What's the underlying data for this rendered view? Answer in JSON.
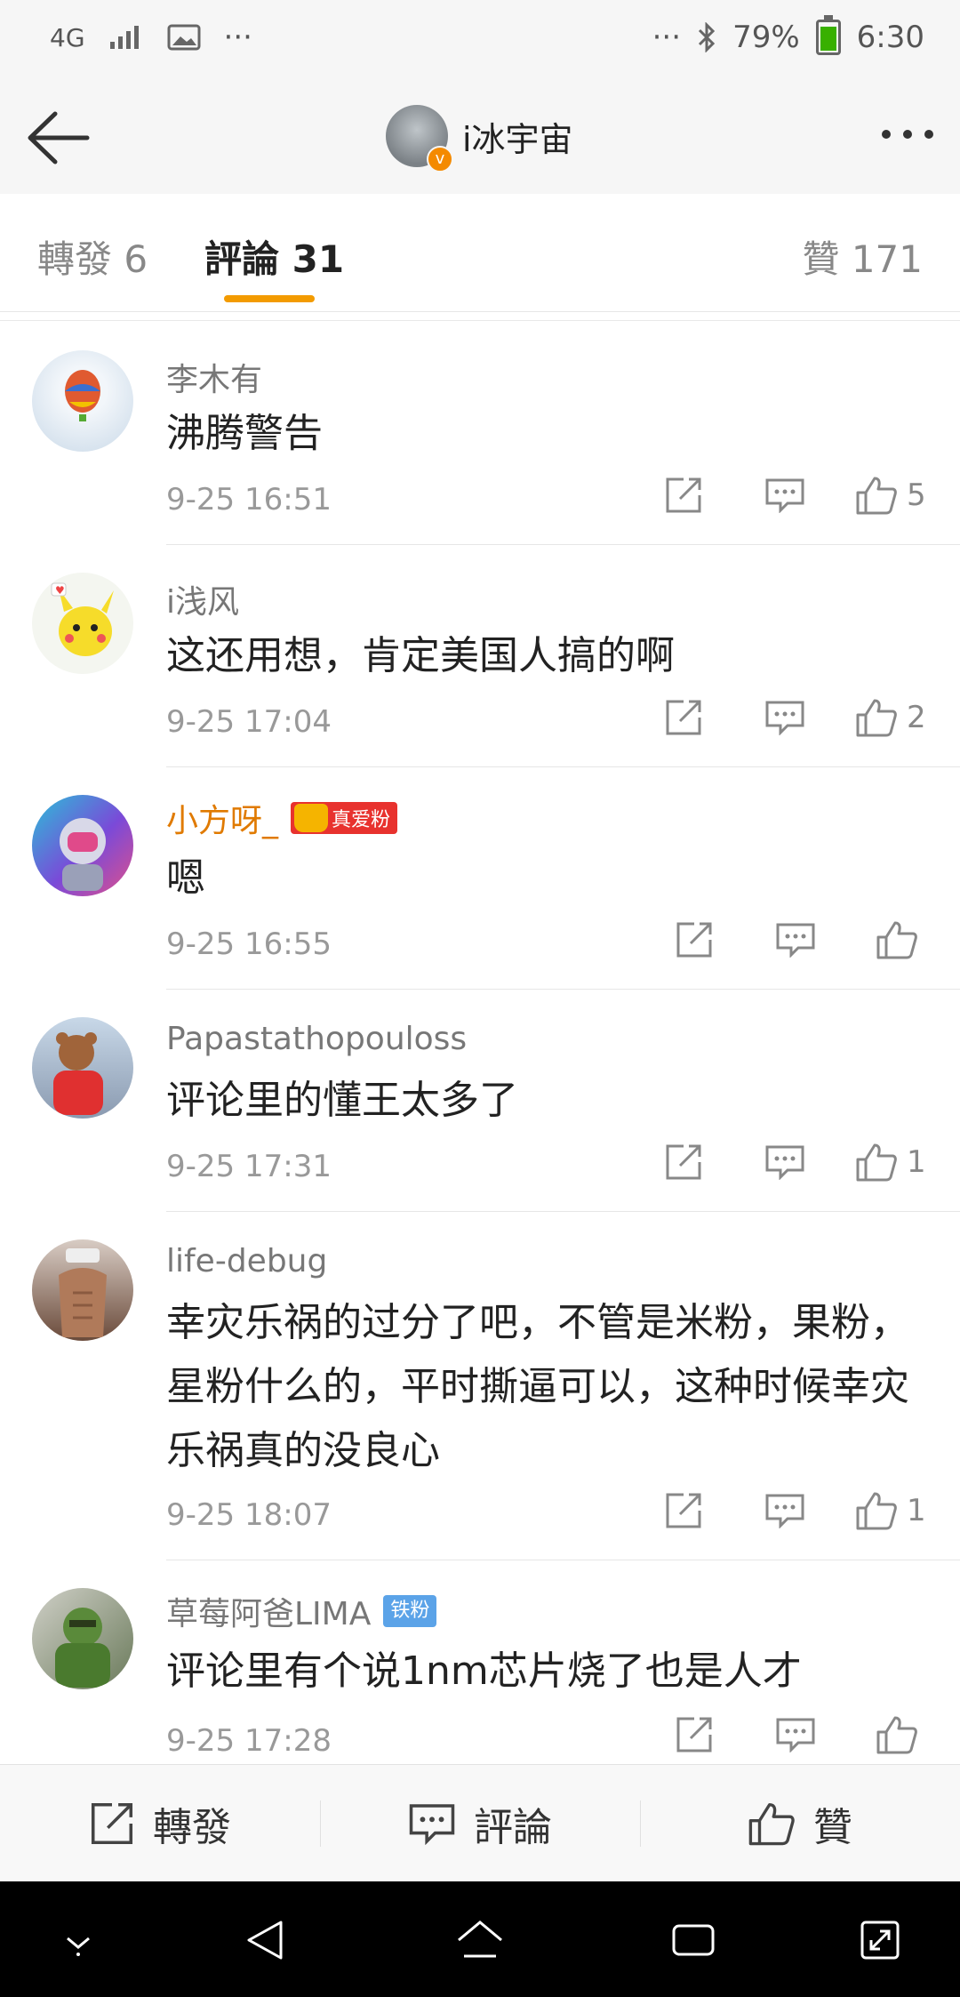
{
  "status_bar": {
    "network": "4G",
    "left_icons": [
      "signal-icon",
      "image-icon",
      "more-dots-icon"
    ],
    "right_icons": [
      "more-dots-icon",
      "bluetooth-icon",
      "battery-icon"
    ],
    "battery": "79%",
    "time": "6:30"
  },
  "header": {
    "title": "i冰宇宙",
    "badge": "v"
  },
  "tabs": {
    "repost": "轉發 6",
    "comments": "評論 31",
    "likes": "贊 171"
  },
  "comments": [
    {
      "user": "李木有",
      "text": "沸腾警告",
      "time": "9-25 16:51",
      "likes": "5",
      "avatar_color": "#c9d9e8"
    },
    {
      "user": "i浅风",
      "text": "这还用想，肯定美国人搞的啊",
      "time": "9-25 17:04",
      "likes": "2",
      "avatar_color": "#f2ec9a"
    },
    {
      "user": "小方呀_",
      "badge": "真爱粉",
      "text": "嗯",
      "time": "9-25 16:55",
      "likes": "",
      "avatar_color": "#6a8ad8"
    },
    {
      "user": "Papastathopouloss",
      "text": "评论里的懂王太多了",
      "time": "9-25 17:31",
      "likes": "1",
      "avatar_color": "#b46a3c"
    },
    {
      "user": "life-debug",
      "text": "幸灾乐祸的过分了吧，不管是米粉，果粉，星粉什么的，平时撕逼可以，这种时候幸灾乐祸真的没良心",
      "time": "9-25 18:07",
      "likes": "1",
      "avatar_color": "#8b6b5a"
    },
    {
      "user": "草莓阿爸LIMA",
      "badge": "铁粉",
      "text": "评论里有个说1nm芯片烧了也是人才",
      "time": "9-25 17:28",
      "likes": "",
      "avatar_color": "#5a7a4a"
    }
  ],
  "bottom_bar": {
    "repost": "轉發",
    "comment": "評論",
    "like": "贊"
  }
}
